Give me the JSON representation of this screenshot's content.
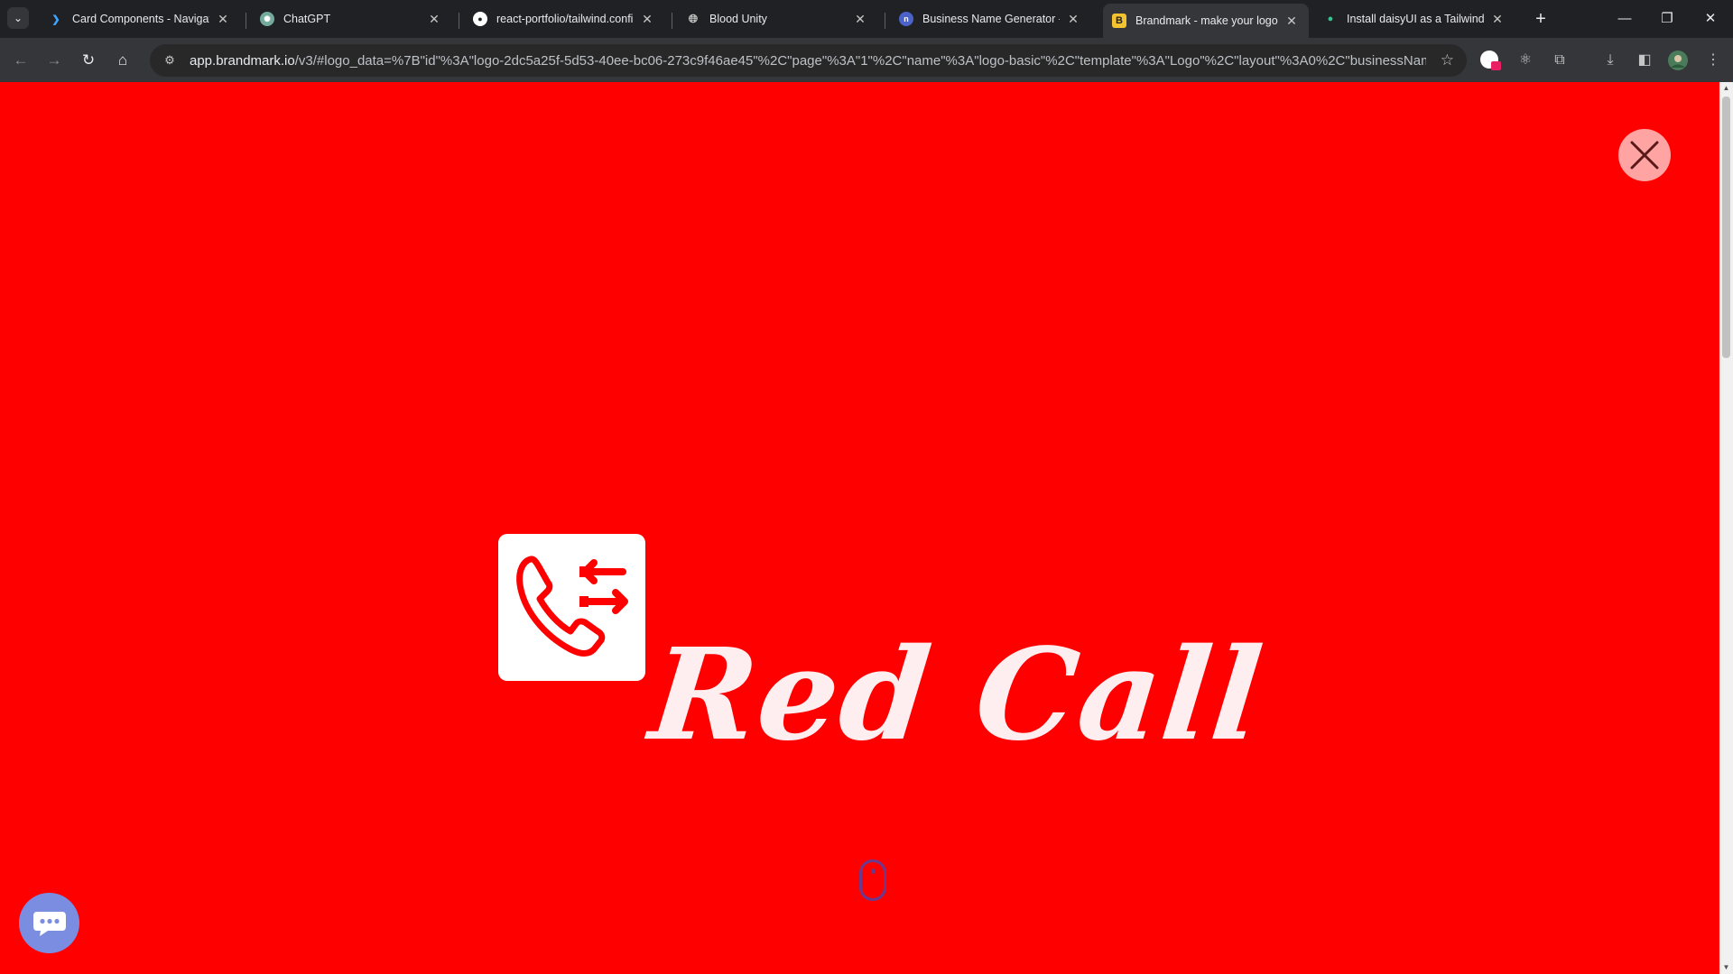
{
  "browser": {
    "tabs": [
      {
        "title": "Card Components - Navigate UI",
        "favicon": "navigate-ui-icon"
      },
      {
        "title": "ChatGPT",
        "favicon": "chatgpt-icon"
      },
      {
        "title": "react-portfolio/tailwind.config.js",
        "favicon": "github-icon"
      },
      {
        "title": "Blood Unity",
        "favicon": "globe-icon"
      },
      {
        "title": "Business Name Generator - Powered",
        "favicon": "namelix-icon"
      },
      {
        "title": "Brandmark - make your logo in",
        "favicon": "brandmark-icon",
        "active": true
      },
      {
        "title": "Install daisyUI as a Tailwind CSS",
        "favicon": "daisyui-icon"
      }
    ],
    "url_host": "app.brandmark.io",
    "url_rest": "/v3/#logo_data=%7B\"id\"%3A\"logo-2dc5a25f-5d53-40ee-bc06-273c9f46ae45\"%2C\"page\"%3A\"1\"%2C\"name\"%3A\"logo-basic\"%2C\"template\"%3A\"Logo\"%2C\"layout\"%3A0%2C\"businessName\"%..."
  },
  "page": {
    "background": "#ff0000",
    "logo_text": "Red Call",
    "logo_text_color": "#ffeef0",
    "logo_mark_bg": "#ffffff",
    "logo_mark_icon": "phone-transfer-icon"
  },
  "colors": {
    "close_button_bg": "#ffa3a3",
    "chat_button_bg": "#7a8de0",
    "scroll_hint_color": "#6b3a8f"
  }
}
